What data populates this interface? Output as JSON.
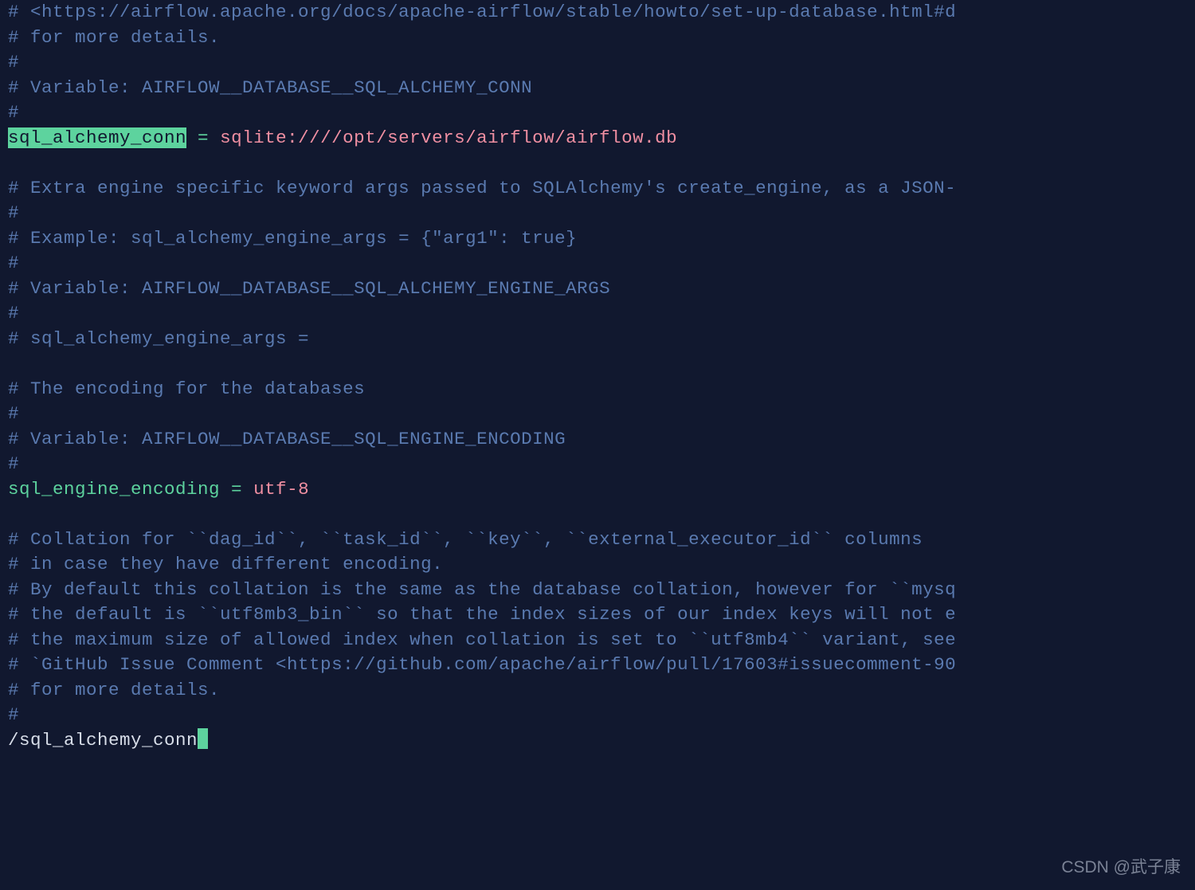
{
  "lines": [
    {
      "type": "comment",
      "text": "# <https://airflow.apache.org/docs/apache-airflow/stable/howto/set-up-database.html#d"
    },
    {
      "type": "comment",
      "text": "# for more details."
    },
    {
      "type": "comment",
      "text": "#"
    },
    {
      "type": "comment",
      "text": "# Variable: AIRFLOW__DATABASE__SQL_ALCHEMY_CONN"
    },
    {
      "type": "comment",
      "text": "#"
    },
    {
      "type": "assign_hl",
      "key": "sql_alchemy_conn",
      "eq": " = ",
      "scheme": "sqlite:",
      "path": "////opt/servers/airflow/airflow.db"
    },
    {
      "type": "blank",
      "text": ""
    },
    {
      "type": "comment",
      "text": "# Extra engine specific keyword args passed to SQLAlchemy's create_engine, as a JSON-"
    },
    {
      "type": "comment",
      "text": "#"
    },
    {
      "type": "comment",
      "text": "# Example: sql_alchemy_engine_args = {\"arg1\": true}"
    },
    {
      "type": "comment",
      "text": "#"
    },
    {
      "type": "comment",
      "text": "# Variable: AIRFLOW__DATABASE__SQL_ALCHEMY_ENGINE_ARGS"
    },
    {
      "type": "comment",
      "text": "#"
    },
    {
      "type": "comment",
      "text": "# sql_alchemy_engine_args ="
    },
    {
      "type": "blank",
      "text": ""
    },
    {
      "type": "comment",
      "text": "# The encoding for the databases"
    },
    {
      "type": "comment",
      "text": "#"
    },
    {
      "type": "comment",
      "text": "# Variable: AIRFLOW__DATABASE__SQL_ENGINE_ENCODING"
    },
    {
      "type": "comment",
      "text": "#"
    },
    {
      "type": "assign",
      "key": "sql_engine_encoding",
      "eq": " = ",
      "value": "utf-8"
    },
    {
      "type": "blank",
      "text": ""
    },
    {
      "type": "comment",
      "text": "# Collation for ``dag_id``, ``task_id``, ``key``, ``external_executor_id`` columns"
    },
    {
      "type": "comment",
      "text": "# in case they have different encoding."
    },
    {
      "type": "comment",
      "text": "# By default this collation is the same as the database collation, however for ``mysq"
    },
    {
      "type": "comment",
      "text": "# the default is ``utf8mb3_bin`` so that the index sizes of our index keys will not e"
    },
    {
      "type": "comment",
      "text": "# the maximum size of allowed index when collation is set to ``utf8mb4`` variant, see"
    },
    {
      "type": "comment",
      "text": "# `GitHub Issue Comment <https://github.com/apache/airflow/pull/17603#issuecomment-90"
    },
    {
      "type": "comment",
      "text": "# for more details."
    },
    {
      "type": "comment",
      "text": "#"
    }
  ],
  "search": {
    "prefix": "/",
    "term": "sql_alchemy_conn"
  },
  "watermark": "CSDN @武子康"
}
